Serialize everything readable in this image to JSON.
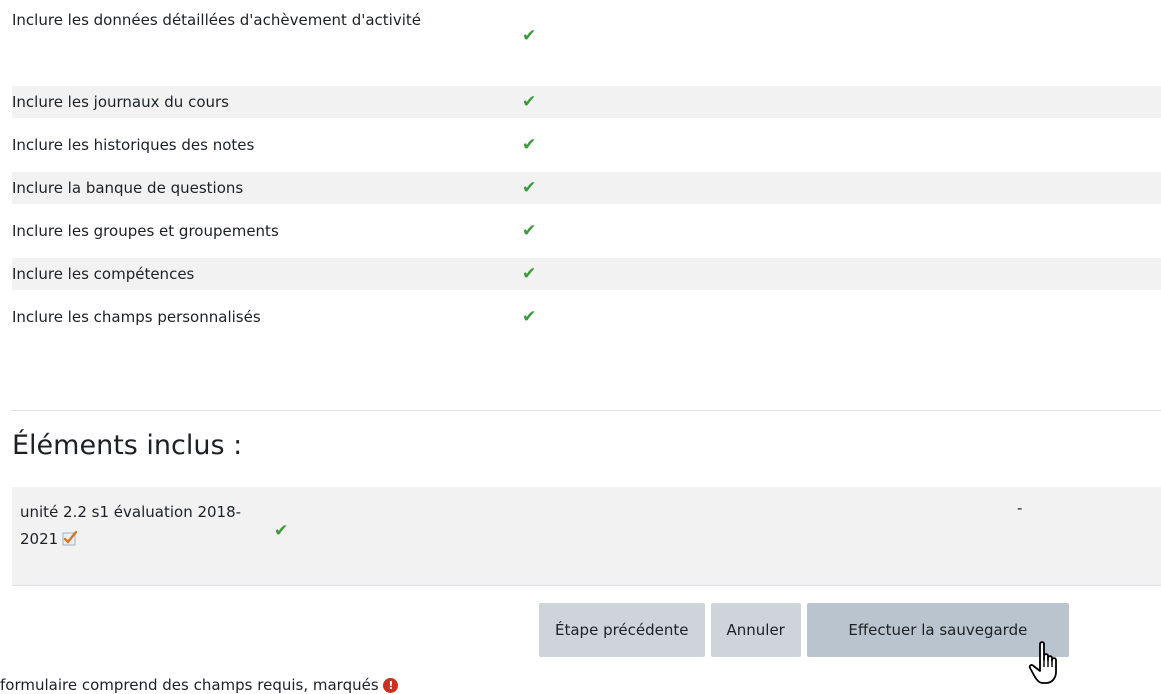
{
  "settings": {
    "rows": [
      {
        "label": "Inclure les données détaillées d'achèvement d'activité",
        "check": "✔"
      },
      {
        "label": "Inclure les journaux du cours",
        "check": "✔"
      },
      {
        "label": "Inclure les historiques des notes",
        "check": "✔"
      },
      {
        "label": "Inclure la banque de questions",
        "check": "✔"
      },
      {
        "label": "Inclure les groupes et groupements",
        "check": "✔"
      },
      {
        "label": "Inclure les compétences",
        "check": "✔"
      },
      {
        "label": "Inclure les champs personnalisés",
        "check": "✔"
      }
    ]
  },
  "included": {
    "title": "Éléments inclus :",
    "item_name": "unité 2.2 s1 évaluation 2018-2021",
    "item_check": "✔",
    "item_value": "-"
  },
  "buttons": {
    "previous": "Étape précédente",
    "cancel": "Annuler",
    "perform": "Effectuer la sauvegarde"
  },
  "footer": {
    "note": "formulaire comprend des champs requis, marqués",
    "required_icon": "!"
  },
  "colors": {
    "check": "#3d9a3d",
    "alt_row": "#f2f2f2",
    "button": "#ced4da",
    "required": "#ca3120"
  }
}
